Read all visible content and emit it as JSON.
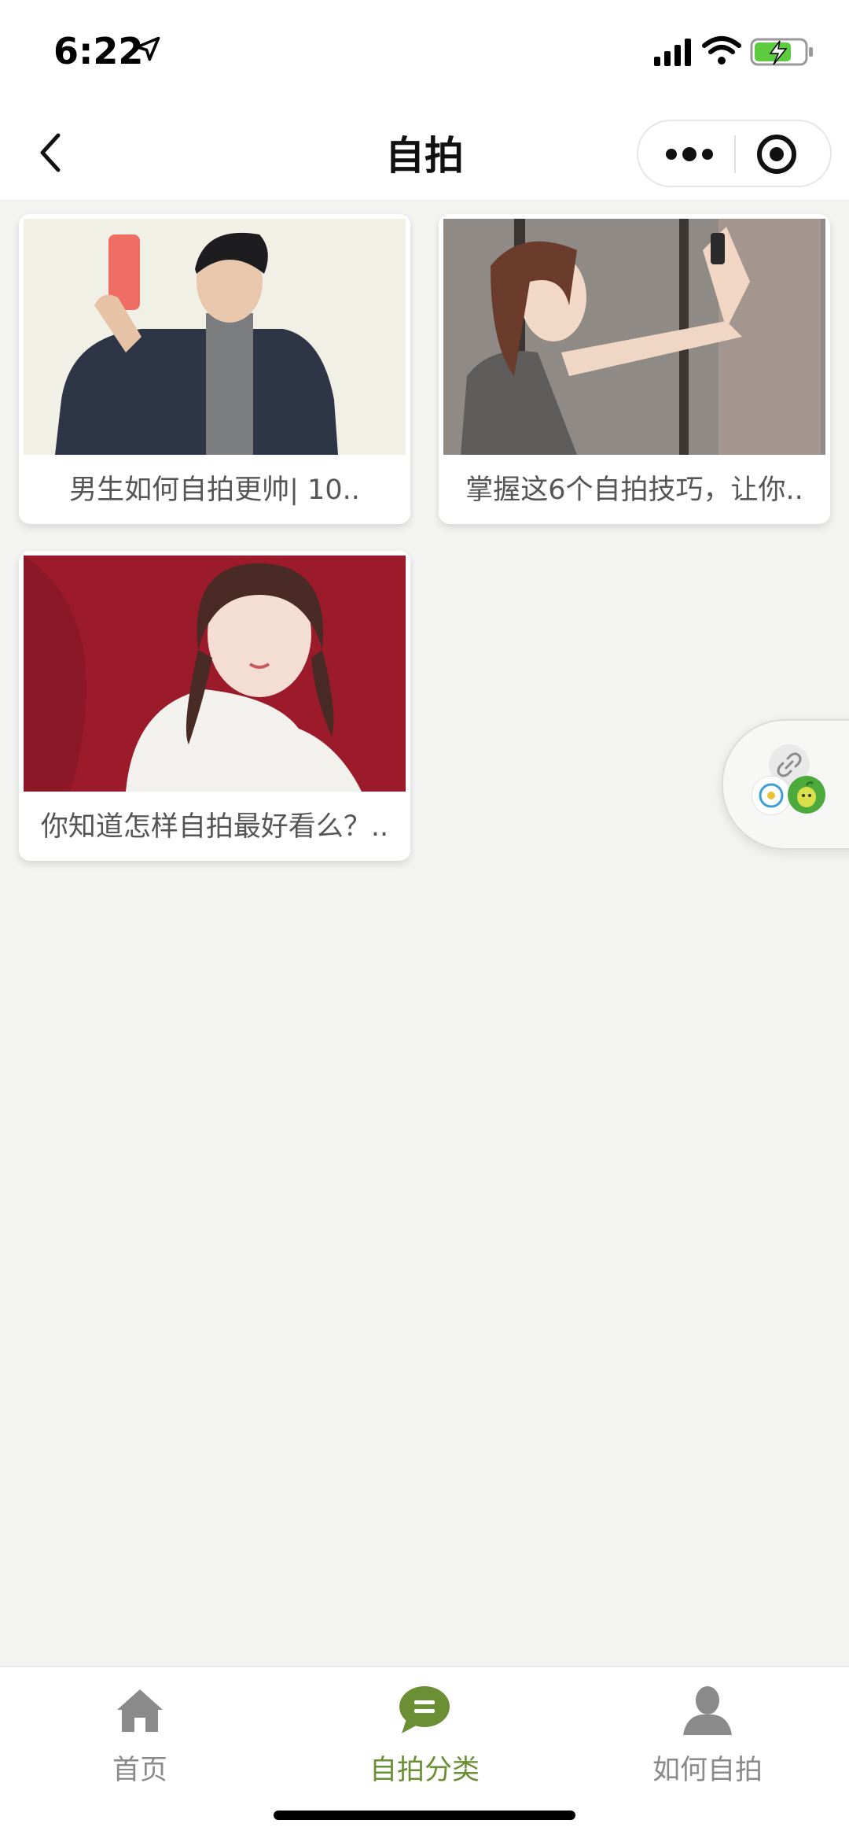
{
  "status_bar": {
    "time": "6:22",
    "icons": [
      "location-arrow-icon",
      "cellular-signal-icon",
      "wifi-icon",
      "battery-charging-icon"
    ]
  },
  "nav": {
    "title": "自拍",
    "back_icon": "chevron-left-icon",
    "more_icon": "more-dots-icon",
    "close_icon": "target-circle-icon"
  },
  "cards": [
    {
      "title": "男生如何自拍更帅| 10.."
    },
    {
      "title": "掌握这6个自拍技巧，让你.."
    },
    {
      "title": "你知道怎样自拍最好看么？.."
    }
  ],
  "tabs": [
    {
      "label": "首页",
      "icon": "home-icon",
      "active": false
    },
    {
      "label": "自拍分类",
      "icon": "chat-bubble-icon",
      "active": true
    },
    {
      "label": "如何自拍",
      "icon": "person-icon",
      "active": false
    }
  ],
  "colors": {
    "active_tab": "#6a8f35",
    "inactive_tab": "#8a8a8a",
    "background": "#f3f3f1"
  }
}
